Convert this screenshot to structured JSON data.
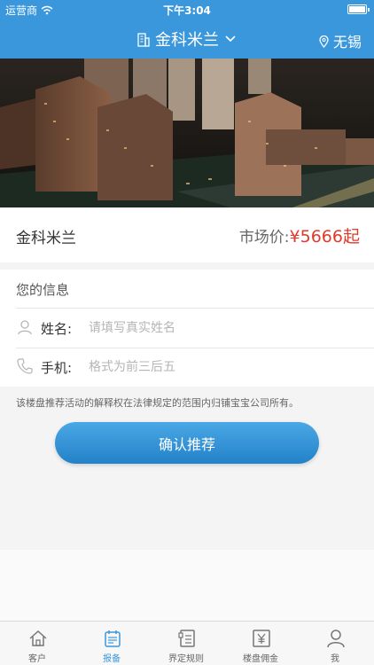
{
  "statusbar": {
    "carrier": "运营商",
    "time": "下午3:04"
  },
  "navbar": {
    "title": "金科米兰",
    "city": "无锡"
  },
  "project": {
    "name": "金科米兰",
    "price_label": "市场价:",
    "price_value": "¥5666起"
  },
  "form": {
    "header": "您的信息",
    "name_label": "姓名:",
    "name_placeholder": "请填写真实姓名",
    "name_value": "",
    "phone_label": "手机:",
    "phone_placeholder": "格式为前三后五",
    "phone_value": ""
  },
  "disclaimer": "该楼盘推荐活动的解释权在法律规定的范围内归铺宝宝公司所有。",
  "confirm_label": "确认推荐",
  "tabs": [
    {
      "label": "客户",
      "icon": "house-icon"
    },
    {
      "label": "报备",
      "icon": "clipboard-icon"
    },
    {
      "label": "界定规则",
      "icon": "document-icon"
    },
    {
      "label": "楼盘佣金",
      "icon": "yen-icon"
    },
    {
      "label": "我",
      "icon": "person-icon"
    }
  ],
  "active_tab": 1,
  "colors": {
    "accent": "#3b97dc",
    "price": "#e03a2c"
  }
}
